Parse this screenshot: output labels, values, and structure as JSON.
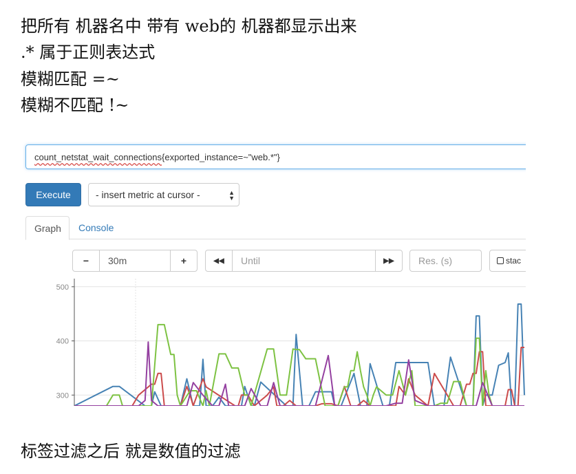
{
  "notes": {
    "line0": "把所有 机器名中 带有 web的 机器都显示出来",
    "line1": ".* 属于正则表达式",
    "line2": "模糊匹配   =~",
    "line3": "模糊不匹配  !~",
    "footer": "标签过滤之后 就是数值的过滤"
  },
  "prometheus": {
    "expression": {
      "metric": "count_netstat_wait_connections",
      "selector": "{exported_instance=~\"web.*\"}"
    },
    "execute_label": "Execute",
    "metric_select": "- insert metric at cursor -",
    "tabs": [
      "Graph",
      "Console"
    ],
    "controls": {
      "minus": "−",
      "range": "30m",
      "plus": "+",
      "back": "◀◀",
      "until_placeholder": "Until",
      "forward": "▶▶",
      "res_placeholder": "Res. (s)",
      "stacked_label": "stac"
    }
  },
  "chart_data": {
    "type": "line",
    "yticks": [
      500,
      400,
      300
    ],
    "ylim": [
      280,
      515
    ],
    "grid": true,
    "colors": {
      "blue": "#4682b4",
      "red": "#cb4b4b",
      "green": "#7dc242",
      "purple": "#9440a0"
    },
    "series": [
      {
        "color_key": "blue",
        "x": [
          0,
          12,
          14,
          22,
          24,
          25,
          27,
          33,
          35,
          37,
          39,
          40,
          41,
          43,
          45,
          47,
          52,
          53,
          55,
          56,
          58,
          66,
          68,
          69,
          71,
          73,
          75,
          80,
          81,
          83,
          87,
          89,
          91,
          92,
          96,
          98,
          100,
          110,
          112,
          115,
          117,
          122,
          124,
          125,
          126,
          127,
          128,
          130,
          132,
          134,
          135,
          136,
          137,
          138,
          139,
          140
        ],
        "y": [
          280,
          316,
          316,
          280,
          280,
          306,
          280,
          280,
          330,
          280,
          280,
          366,
          280,
          280,
          296,
          280,
          280,
          316,
          280,
          280,
          324,
          280,
          280,
          412,
          280,
          280,
          306,
          306,
          280,
          280,
          340,
          280,
          280,
          358,
          280,
          280,
          360,
          360,
          280,
          280,
          370,
          280,
          280,
          446,
          446,
          280,
          300,
          300,
          355,
          360,
          378,
          280,
          280,
          468,
          468,
          300
        ]
      },
      {
        "color_key": "red",
        "x": [
          0,
          18,
          20,
          24,
          25,
          26,
          27,
          28,
          30,
          33,
          35,
          36,
          37,
          40,
          41,
          50,
          51,
          52,
          54,
          56,
          60,
          62,
          63,
          65,
          67,
          69,
          75,
          77,
          80,
          82,
          84,
          86,
          88,
          90,
          92,
          100,
          101,
          103,
          104,
          106,
          110,
          112,
          116,
          118,
          120,
          122,
          123,
          124,
          125,
          126,
          127,
          128,
          129,
          130,
          131,
          134,
          135,
          136,
          137,
          138,
          139,
          140
        ],
        "y": [
          280,
          280,
          300,
          320,
          320,
          340,
          340,
          280,
          280,
          280,
          316,
          300,
          280,
          330,
          315,
          280,
          280,
          300,
          300,
          280,
          300,
          315,
          280,
          280,
          290,
          280,
          280,
          284,
          284,
          280,
          316,
          280,
          280,
          290,
          280,
          280,
          316,
          300,
          330,
          300,
          280,
          340,
          300,
          280,
          280,
          320,
          320,
          340,
          340,
          380,
          380,
          280,
          280,
          280,
          280,
          280,
          310,
          310,
          280,
          280,
          388,
          388
        ]
      },
      {
        "color_key": "green",
        "x": [
          0,
          10,
          12,
          14,
          15,
          17,
          19,
          24,
          26,
          28,
          30,
          31,
          32,
          33,
          36,
          38,
          40,
          41,
          42,
          45,
          47,
          49,
          51,
          53,
          54,
          55,
          60,
          62,
          64,
          66,
          68,
          69,
          70,
          72,
          75,
          78,
          80,
          82,
          84,
          85,
          86,
          87,
          88,
          89,
          90,
          91,
          92,
          93,
          94,
          97,
          99,
          101,
          103,
          105,
          106,
          107,
          108,
          110,
          112,
          114,
          116,
          118,
          120,
          122,
          124,
          125,
          126,
          127,
          128,
          129,
          130,
          131,
          132,
          133,
          135,
          137,
          139,
          140
        ],
        "y": [
          280,
          280,
          300,
          300,
          280,
          280,
          280,
          280,
          430,
          430,
          375,
          375,
          300,
          280,
          308,
          308,
          280,
          308,
          280,
          376,
          376,
          350,
          350,
          300,
          300,
          280,
          385,
          385,
          300,
          300,
          385,
          384,
          384,
          367,
          367,
          280,
          280,
          280,
          315,
          315,
          345,
          345,
          380,
          345,
          315,
          300,
          280,
          300,
          315,
          300,
          300,
          345,
          300,
          345,
          280,
          280,
          280,
          280,
          280,
          285,
          285,
          325,
          325,
          280,
          280,
          405,
          405,
          280,
          345,
          300,
          280,
          280,
          280,
          280,
          280,
          280,
          280,
          280
        ]
      },
      {
        "color_key": "purple",
        "x": [
          0,
          20,
          22,
          23,
          24,
          26,
          35,
          37,
          40,
          43,
          45,
          47,
          48,
          53,
          55,
          58,
          60,
          62,
          64,
          68,
          70,
          73,
          75,
          79,
          81,
          85,
          88,
          90,
          92,
          95,
          97,
          100,
          102,
          104,
          106,
          110,
          112,
          115,
          117,
          120,
          125,
          127,
          130,
          135,
          138,
          140
        ],
        "y": [
          280,
          280,
          290,
          398,
          290,
          280,
          280,
          323,
          300,
          280,
          280,
          320,
          280,
          280,
          312,
          280,
          280,
          323,
          280,
          280,
          280,
          280,
          280,
          373,
          280,
          280,
          280,
          280,
          280,
          280,
          280,
          285,
          285,
          365,
          290,
          280,
          280,
          280,
          280,
          280,
          280,
          323,
          280,
          280,
          280,
          280
        ]
      }
    ]
  }
}
